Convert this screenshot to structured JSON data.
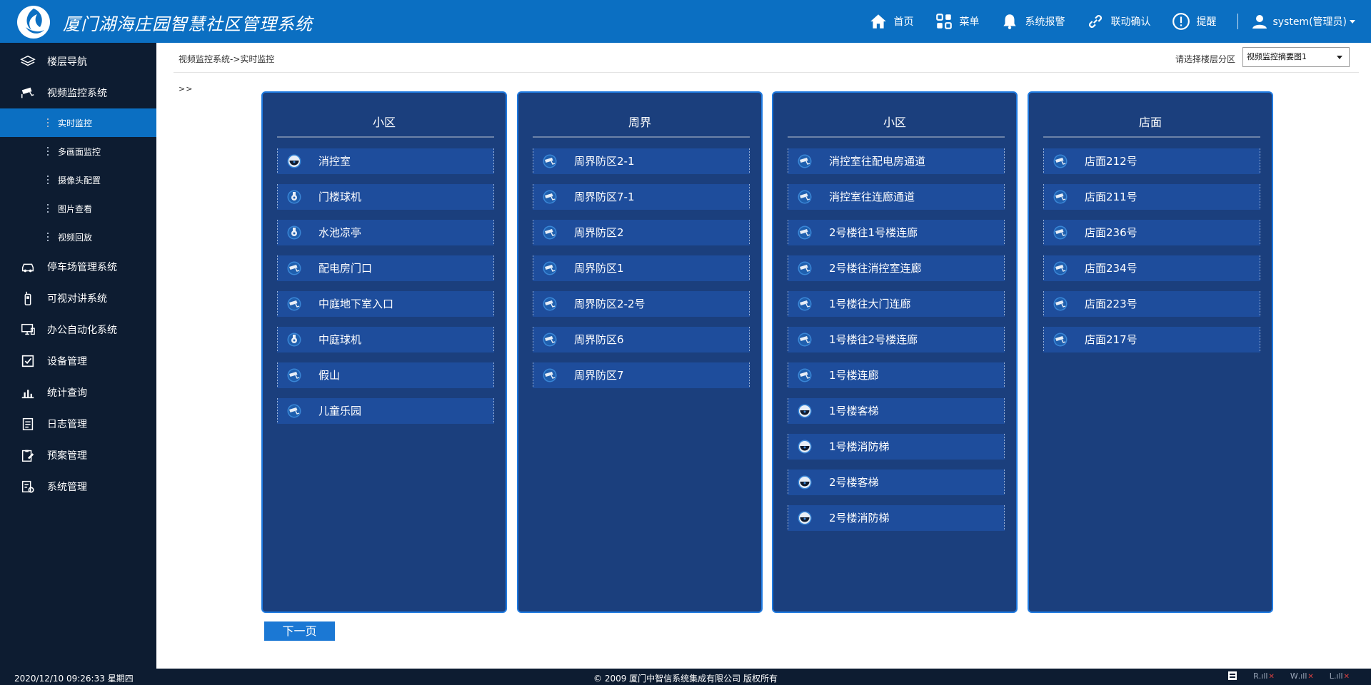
{
  "header": {
    "title": "厦门湖海庄园智慧社区管理系统",
    "nav": [
      {
        "label": "首页",
        "icon": "home-icon"
      },
      {
        "label": "菜单",
        "icon": "grid-icon"
      },
      {
        "label": "系统报警",
        "icon": "bell-icon"
      },
      {
        "label": "联动确认",
        "icon": "link-icon"
      },
      {
        "label": "提醒",
        "icon": "alert-icon"
      }
    ],
    "user": "system(管理员)"
  },
  "sidebar": {
    "items": [
      {
        "label": "楼层导航",
        "icon": "layers-icon"
      },
      {
        "label": "视频监控系统",
        "icon": "cctv-icon"
      },
      {
        "label": "停车场管理系统",
        "icon": "car-icon"
      },
      {
        "label": "可视对讲系统",
        "icon": "intercom-icon"
      },
      {
        "label": "办公自动化系统",
        "icon": "monitor-icon"
      },
      {
        "label": "设备管理",
        "icon": "checkbox-icon"
      },
      {
        "label": "统计查询",
        "icon": "chart-icon"
      },
      {
        "label": "日志管理",
        "icon": "log-icon"
      },
      {
        "label": "预案管理",
        "icon": "plan-icon"
      },
      {
        "label": "系统管理",
        "icon": "settings-icon"
      }
    ],
    "sub_items": [
      "实时监控",
      "多画面监控",
      "摄像头配置",
      "图片查看",
      "视频回放"
    ]
  },
  "breadcrumb": "视频监控系统->实时监控",
  "zone": {
    "label": "请选择楼层分区",
    "selected": "视频监控摘要图1"
  },
  "arrows": ">>",
  "panels": [
    {
      "title": "小区",
      "cameras": [
        {
          "label": "消控室",
          "type": "dome"
        },
        {
          "label": "门楼球机",
          "type": "ptz"
        },
        {
          "label": "水池凉亭",
          "type": "ptz"
        },
        {
          "label": "配电房门口",
          "type": "bullet"
        },
        {
          "label": "中庭地下室入口",
          "type": "bullet"
        },
        {
          "label": "中庭球机",
          "type": "ptz"
        },
        {
          "label": "假山",
          "type": "bullet"
        },
        {
          "label": "儿童乐园",
          "type": "bullet"
        }
      ]
    },
    {
      "title": "周界",
      "cameras": [
        {
          "label": "周界防区2-1",
          "type": "bullet"
        },
        {
          "label": "周界防区7-1",
          "type": "bullet"
        },
        {
          "label": "周界防区2",
          "type": "bullet"
        },
        {
          "label": "周界防区1",
          "type": "bullet"
        },
        {
          "label": "周界防区2-2号",
          "type": "bullet"
        },
        {
          "label": "周界防区6",
          "type": "bullet"
        },
        {
          "label": "周界防区7",
          "type": "bullet"
        }
      ]
    },
    {
      "title": "小区",
      "cameras": [
        {
          "label": "消控室往配电房通道",
          "type": "bullet"
        },
        {
          "label": "消控室往连廊通道",
          "type": "bullet"
        },
        {
          "label": "2号楼往1号楼连廊",
          "type": "bullet"
        },
        {
          "label": "2号楼往消控室连廊",
          "type": "bullet"
        },
        {
          "label": "1号楼往大门连廊",
          "type": "bullet"
        },
        {
          "label": "1号楼往2号楼连廊",
          "type": "bullet"
        },
        {
          "label": "1号楼连廊",
          "type": "bullet"
        },
        {
          "label": "1号楼客梯",
          "type": "dome"
        },
        {
          "label": "1号楼消防梯",
          "type": "dome"
        },
        {
          "label": "2号楼客梯",
          "type": "dome"
        },
        {
          "label": "2号楼消防梯",
          "type": "dome"
        }
      ]
    },
    {
      "title": "店面",
      "cameras": [
        {
          "label": "店面212号",
          "type": "bullet"
        },
        {
          "label": "店面211号",
          "type": "bullet"
        },
        {
          "label": "店面236号",
          "type": "bullet"
        },
        {
          "label": "店面234号",
          "type": "bullet"
        },
        {
          "label": "店面223号",
          "type": "bullet"
        },
        {
          "label": "店面217号",
          "type": "bullet"
        }
      ]
    }
  ],
  "next_page": "下一页",
  "footer": {
    "datetime": "2020/12/10  09:26:33  星期四",
    "copyright": "© 2009 厦门中智信系统集成有限公司  版权所有",
    "signals": [
      "R",
      "W",
      "L"
    ]
  },
  "colors": {
    "header": "#0b6fc2",
    "sidebar": "#0d1c31",
    "panel": "#1b3f7d",
    "panel_border": "#1f7ae0",
    "row": "#1e4d9c",
    "button": "#1b78d4"
  }
}
